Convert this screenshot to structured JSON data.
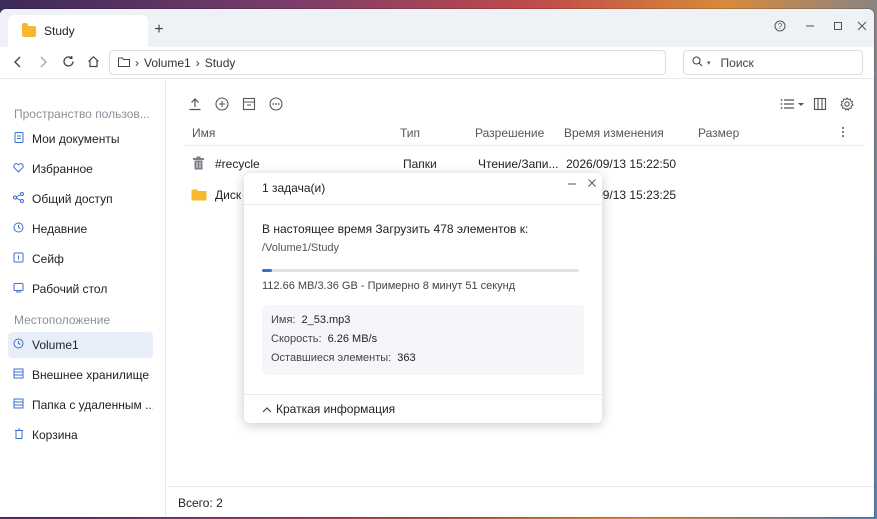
{
  "tab": {
    "title": "Study",
    "new_tab": "+"
  },
  "window_controls": {
    "help": "?",
    "minimize": "—",
    "maximize": "☐",
    "close": "✕"
  },
  "nav": {
    "path": [
      "Volume1",
      "Study"
    ],
    "search_placeholder": "Поиск"
  },
  "sidebar": {
    "section1": "Пространство пользов...",
    "items1": [
      {
        "label": "Мои документы",
        "icon": "document-icon"
      },
      {
        "label": "Избранное",
        "icon": "heart-icon"
      },
      {
        "label": "Общий доступ",
        "icon": "share-icon"
      },
      {
        "label": "Недавние",
        "icon": "clock-icon"
      },
      {
        "label": "Сейф",
        "icon": "safe-icon"
      },
      {
        "label": "Рабочий стол",
        "icon": "desktop-icon"
      }
    ],
    "section2": "Местоположение",
    "items2": [
      {
        "label": "Volume1",
        "icon": "volume-icon",
        "active": true
      },
      {
        "label": "Внешнее хранилище",
        "icon": "storage-icon"
      },
      {
        "label": "Папка с удаленным ...",
        "icon": "remote-folder-icon"
      },
      {
        "label": "Корзина",
        "icon": "trash-icon"
      }
    ]
  },
  "columns": {
    "name": "Имя",
    "type": "Тип",
    "permission": "Разрешение",
    "modified": "Время изменения",
    "size": "Размер"
  },
  "files": [
    {
      "name": "#recycle",
      "type": "Папки",
      "permission": "Чтение/Запи...",
      "modified": "2026/09/13 15:22:50",
      "icon": "trash-icon"
    },
    {
      "name": "Диск",
      "type": "",
      "permission": "",
      "modified": "2026/09/13 15:23:25",
      "icon": "folder-icon"
    }
  ],
  "footer": {
    "total": "Всего: 2"
  },
  "dialog": {
    "title": "1 задача(и)",
    "line1": "В настоящее время Загрузить 478 элементов к:",
    "line2": "/Volume1/Study",
    "progress": 0.03,
    "stats": "112.66 MB/3.36 GB - Примерно 8 минут 51 секунд",
    "details": [
      {
        "label": "Имя:",
        "value": "2_53.mp3"
      },
      {
        "label": "Скорость:",
        "value": "6.26 MB/s"
      },
      {
        "label": "Оставшиеся элементы:",
        "value": "363"
      }
    ],
    "summary": "Краткая информация"
  }
}
